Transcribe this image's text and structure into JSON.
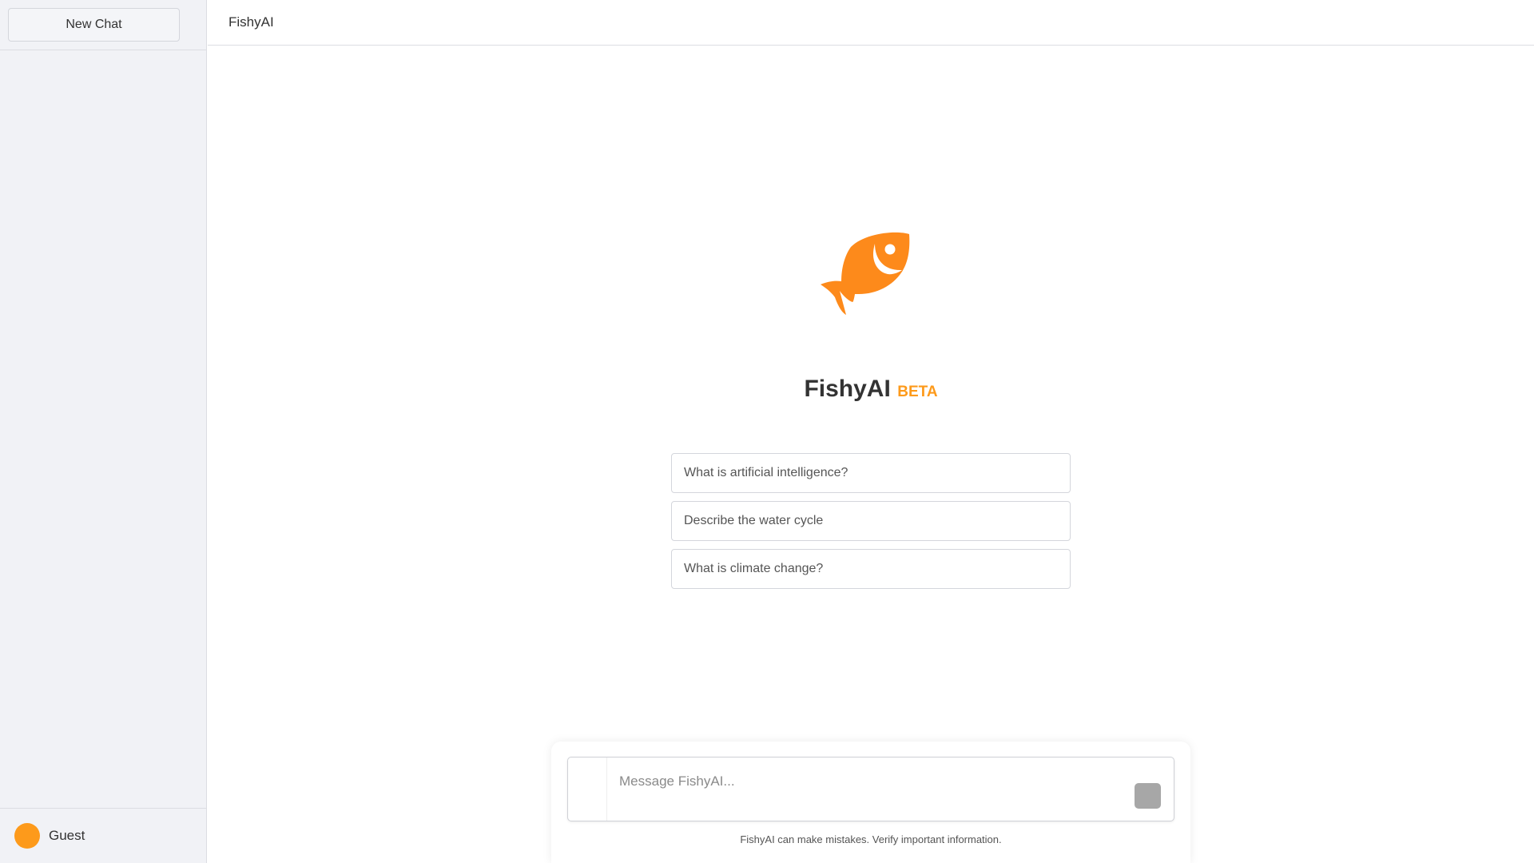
{
  "sidebar": {
    "new_chat_label": "New Chat",
    "user": {
      "name": "Guest",
      "avatar_color": "#fd9a1b"
    }
  },
  "header": {
    "title": "FishyAI"
  },
  "hero": {
    "logo_icon": "fish-icon",
    "name": "FishyAI",
    "badge": "BETA",
    "accent_color": "#fd9a1b"
  },
  "suggestions": [
    "What is artificial intelligence?",
    "Describe the water cycle",
    "What is climate change?"
  ],
  "composer": {
    "placeholder": "Message FishyAI...",
    "value": "",
    "disclaimer": "FishyAI can make mistakes. Verify important information."
  }
}
